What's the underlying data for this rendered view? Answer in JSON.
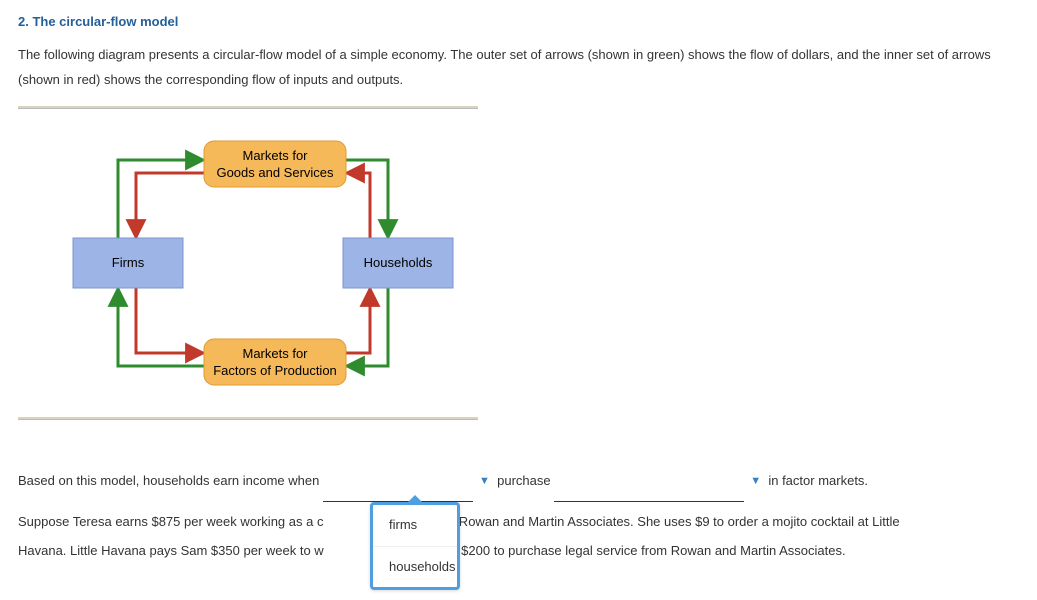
{
  "heading": "2. The circular-flow model",
  "intro": "The following diagram presents a circular-flow model of a simple economy. The outer set of arrows (shown in green) shows the flow of dollars, and the inner set of arrows (shown in red) shows the corresponding flow of inputs and outputs.",
  "diagram": {
    "top_market_line1": "Markets for",
    "top_market_line2": "Goods and Services",
    "left_actor": "Firms",
    "right_actor": "Households",
    "bottom_market_line1": "Markets for",
    "bottom_market_line2": "Factors of Production"
  },
  "question1": {
    "lead": "Based on this model, households earn income when",
    "mid": "purchase",
    "tail": "in factor markets."
  },
  "question2": {
    "part_a": "Suppose Teresa earns $875 per week working as a c",
    "part_b": "ney for Rowan and Martin Associates. She uses $9 to order a mojito cocktail at Little",
    "part_c": "Havana. Little Havana pays Sam $350 per week to w",
    "part_d": "m uses $200 to purchase legal service from Rowan and Martin Associates."
  },
  "dropdown": {
    "option1": "firms",
    "option2": "households"
  }
}
